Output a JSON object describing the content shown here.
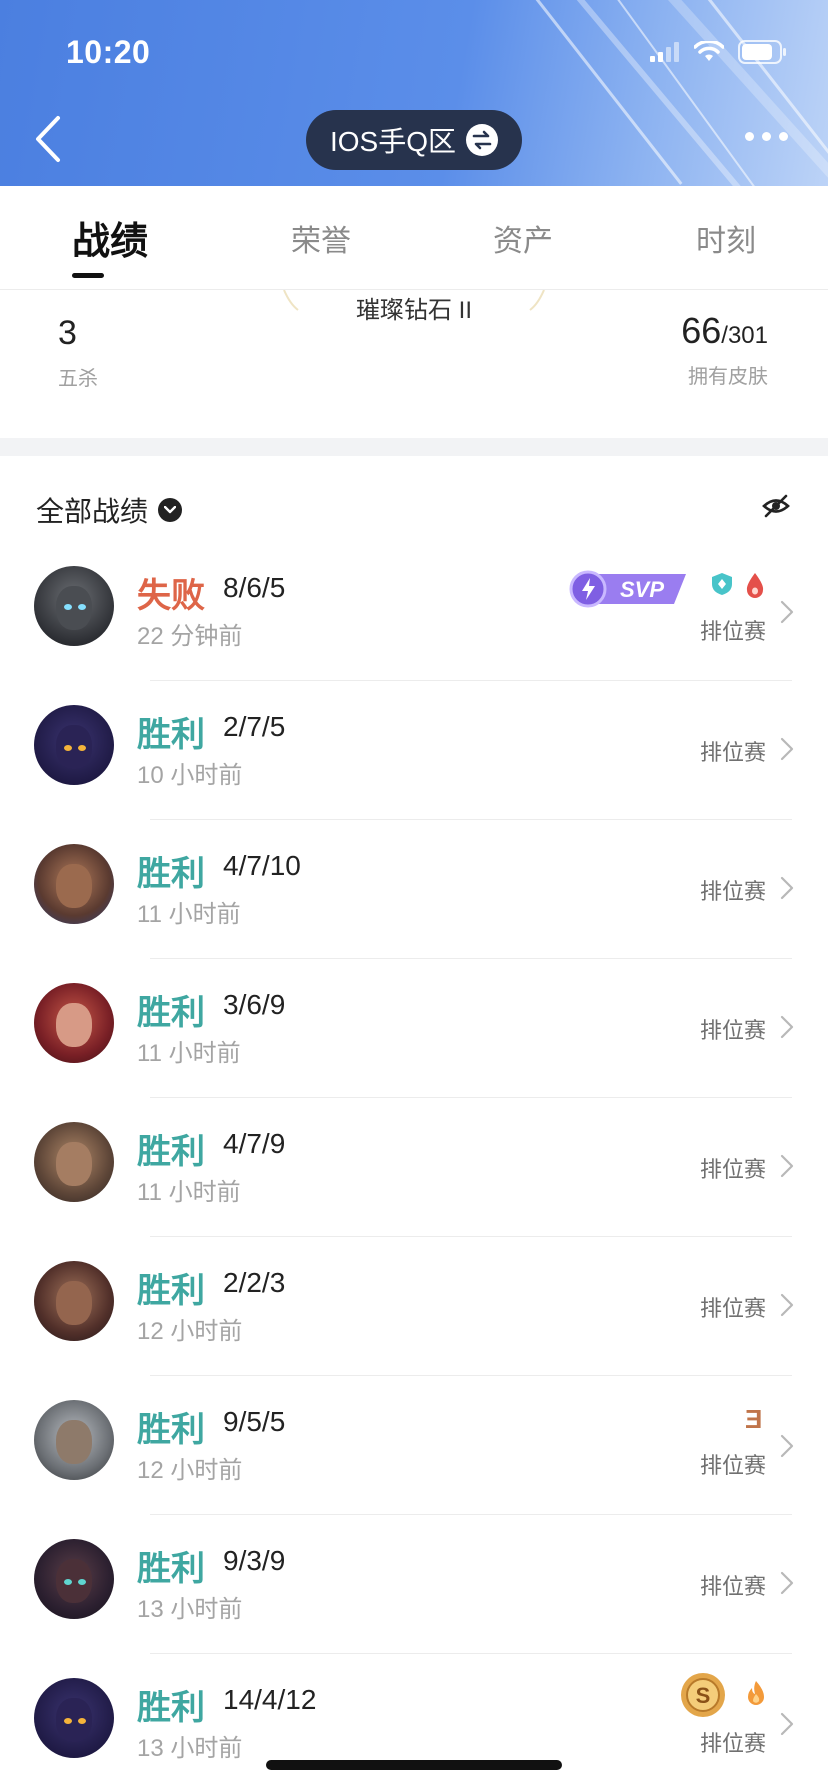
{
  "status_bar": {
    "time": "10:20"
  },
  "header": {
    "server": "IOS手Q区"
  },
  "tabs": [
    {
      "label": "战绩",
      "active": true
    },
    {
      "label": "荣誉",
      "active": false
    },
    {
      "label": "资产",
      "active": false
    },
    {
      "label": "时刻",
      "active": false
    }
  ],
  "stats": {
    "rank": "璀璨钻石 II",
    "pentakills_value": "3",
    "pentakills_label": "五杀",
    "skins_owned": "66",
    "skins_total": "/301",
    "skins_label": "拥有皮肤"
  },
  "section": {
    "title": "全部战绩"
  },
  "colors": {
    "win": "#3fa7a1",
    "lose": "#de6548",
    "header_blue": "#4b7fe0"
  },
  "matches": [
    {
      "result": "失败",
      "outcome": "lose",
      "kda": "8/6/5",
      "ago": "22 分钟前",
      "mode": "排位赛",
      "badges": [
        "svp-badge",
        "shield-icon",
        "drop-icon"
      ],
      "svp_text": "SVP"
    },
    {
      "result": "胜利",
      "outcome": "win",
      "kda": "2/7/5",
      "ago": "10 小时前",
      "mode": "排位赛",
      "badges": []
    },
    {
      "result": "胜利",
      "outcome": "win",
      "kda": "4/7/10",
      "ago": "11 小时前",
      "mode": "排位赛",
      "badges": []
    },
    {
      "result": "胜利",
      "outcome": "win",
      "kda": "3/6/9",
      "ago": "11 小时前",
      "mode": "排位赛",
      "badges": []
    },
    {
      "result": "胜利",
      "outcome": "win",
      "kda": "4/7/9",
      "ago": "11 小时前",
      "mode": "排位赛",
      "badges": []
    },
    {
      "result": "胜利",
      "outcome": "win",
      "kda": "2/2/3",
      "ago": "12 小时前",
      "mode": "排位赛",
      "badges": []
    },
    {
      "result": "胜利",
      "outcome": "win",
      "kda": "9/5/5",
      "ago": "12 小时前",
      "mode": "排位赛",
      "badges": [
        "three-kill-badge"
      ],
      "three_text": "Ǝ"
    },
    {
      "result": "胜利",
      "outcome": "win",
      "kda": "9/3/9",
      "ago": "13 小时前",
      "mode": "排位赛",
      "badges": []
    },
    {
      "result": "胜利",
      "outcome": "win",
      "kda": "14/4/12",
      "ago": "13 小时前",
      "mode": "排位赛",
      "badges": [
        "coin-s-icon",
        "fire-icon"
      ],
      "coin_text": "S"
    }
  ]
}
